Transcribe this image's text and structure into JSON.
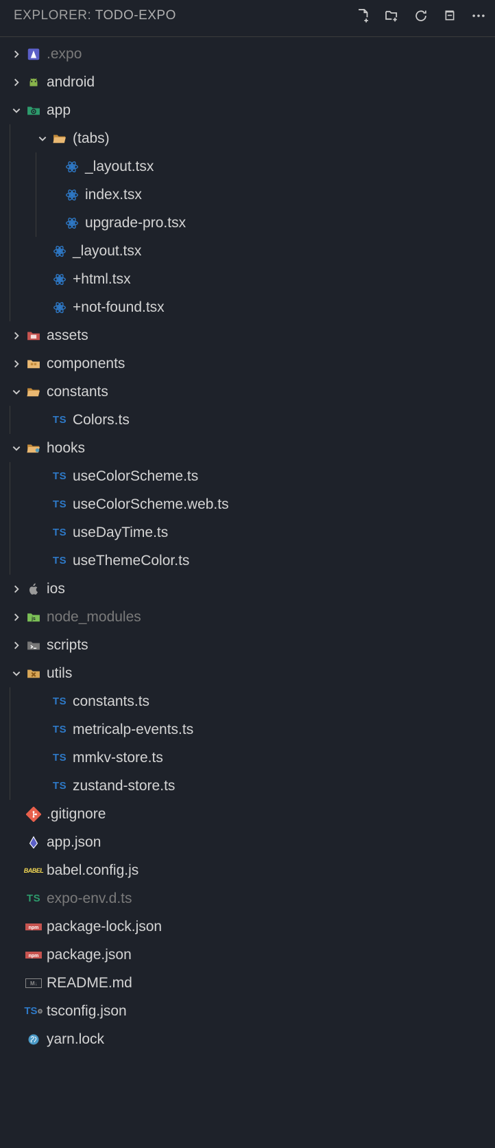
{
  "header": {
    "label": "EXPLORER: ",
    "project": "TODO-EXPO"
  },
  "tree": [
    {
      "depth": 0,
      "chev": "right",
      "icon": "expo",
      "name": ".expo",
      "dim": true
    },
    {
      "depth": 0,
      "chev": "right",
      "icon": "android",
      "name": "android"
    },
    {
      "depth": 0,
      "chev": "down",
      "icon": "folder-gear",
      "name": "app"
    },
    {
      "depth": 1,
      "chev": "down",
      "icon": "folder-open",
      "name": "(tabs)"
    },
    {
      "depth": 2,
      "chev": "",
      "icon": "react",
      "name": "_layout.tsx"
    },
    {
      "depth": 2,
      "chev": "",
      "icon": "react",
      "name": "index.tsx"
    },
    {
      "depth": 2,
      "chev": "",
      "icon": "react",
      "name": "upgrade-pro.tsx"
    },
    {
      "depth": 1,
      "chev": "",
      "icon": "react",
      "name": "_layout.tsx"
    },
    {
      "depth": 1,
      "chev": "",
      "icon": "react",
      "name": "+html.tsx"
    },
    {
      "depth": 1,
      "chev": "",
      "icon": "react",
      "name": "+not-found.tsx"
    },
    {
      "depth": 0,
      "chev": "right",
      "icon": "assets",
      "name": "assets"
    },
    {
      "depth": 0,
      "chev": "right",
      "icon": "components",
      "name": "components"
    },
    {
      "depth": 0,
      "chev": "down",
      "icon": "folder-open",
      "name": "constants"
    },
    {
      "depth": 1,
      "chev": "",
      "icon": "ts",
      "name": "Colors.ts"
    },
    {
      "depth": 0,
      "chev": "down",
      "icon": "folder-hooks",
      "name": "hooks"
    },
    {
      "depth": 1,
      "chev": "",
      "icon": "ts",
      "name": "useColorScheme.ts"
    },
    {
      "depth": 1,
      "chev": "",
      "icon": "ts",
      "name": "useColorScheme.web.ts"
    },
    {
      "depth": 1,
      "chev": "",
      "icon": "ts",
      "name": "useDayTime.ts"
    },
    {
      "depth": 1,
      "chev": "",
      "icon": "ts",
      "name": "useThemeColor.ts"
    },
    {
      "depth": 0,
      "chev": "right",
      "icon": "apple",
      "name": "ios"
    },
    {
      "depth": 0,
      "chev": "right",
      "icon": "nodejs",
      "name": "node_modules",
      "dim": true
    },
    {
      "depth": 0,
      "chev": "right",
      "icon": "scripts",
      "name": "scripts"
    },
    {
      "depth": 0,
      "chev": "down",
      "icon": "utils",
      "name": "utils"
    },
    {
      "depth": 1,
      "chev": "",
      "icon": "ts",
      "name": "constants.ts"
    },
    {
      "depth": 1,
      "chev": "",
      "icon": "ts",
      "name": "metricalp-events.ts"
    },
    {
      "depth": 1,
      "chev": "",
      "icon": "ts",
      "name": "mmkv-store.ts"
    },
    {
      "depth": 1,
      "chev": "",
      "icon": "ts",
      "name": "zustand-store.ts"
    },
    {
      "depth": 0,
      "chev": "",
      "icon": "git",
      "name": ".gitignore"
    },
    {
      "depth": 0,
      "chev": "",
      "icon": "json-expo",
      "name": "app.json"
    },
    {
      "depth": 0,
      "chev": "",
      "icon": "babel",
      "name": "babel.config.js"
    },
    {
      "depth": 0,
      "chev": "",
      "icon": "ts-green",
      "name": "expo-env.d.ts",
      "dim": true
    },
    {
      "depth": 0,
      "chev": "",
      "icon": "npm",
      "name": "package-lock.json"
    },
    {
      "depth": 0,
      "chev": "",
      "icon": "npm",
      "name": "package.json"
    },
    {
      "depth": 0,
      "chev": "",
      "icon": "md",
      "name": "README.md"
    },
    {
      "depth": 0,
      "chev": "",
      "icon": "ts-gear",
      "name": "tsconfig.json"
    },
    {
      "depth": 0,
      "chev": "",
      "icon": "yarn",
      "name": "yarn.lock"
    }
  ]
}
